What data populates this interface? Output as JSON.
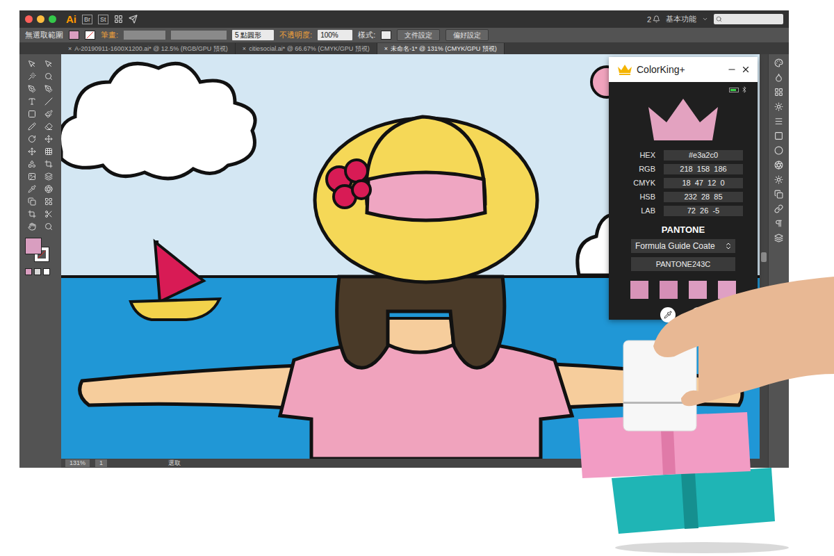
{
  "app": {
    "logo": "Ai",
    "bridge": "Br",
    "stock": "St",
    "notifications": "2",
    "workspace": "基本功能"
  },
  "control_bar": {
    "selection": "無選取範圍",
    "fill": "#d99ec0",
    "stroke_label": "筆畫:",
    "brush": "5 點圓形",
    "opacity_label": "不透明度:",
    "opacity": "100%",
    "style_label": "樣式:",
    "buttons": [
      "文件設定",
      "偏好設定"
    ]
  },
  "tabs": [
    {
      "close": "×",
      "label": "A-20190911-1600X1200.ai* @ 12.5% (RGB/GPU 預視)",
      "selected": false
    },
    {
      "close": "×",
      "label": "citiesocial.ai* @ 66.67% (CMYK/GPU 預視)",
      "selected": false
    },
    {
      "close": "×",
      "label": "未命名-1* @ 131% (CMYK/GPU 預視)",
      "selected": true
    }
  ],
  "tools": {
    "fill": "#d99ec0"
  },
  "status_bar": {
    "zoom": "131%",
    "page": "1",
    "tool": "選取"
  },
  "colorking": {
    "title": "ColorKing+",
    "battery_level": 0.8,
    "bluetooth": true,
    "color": "#e3a2c0",
    "readings": [
      {
        "label": "HEX",
        "value": "#e3a2c0"
      },
      {
        "label": "RGB",
        "value": "218  158  186"
      },
      {
        "label": "CMYK",
        "value": "18  47  12  0"
      },
      {
        "label": "HSB",
        "value": "232  28  85"
      },
      {
        "label": "LAB",
        "value": "72  26  -5"
      }
    ],
    "pantone": {
      "brand": "PANTONE",
      "guide": "Formula Guide Coate",
      "match": "PANTONE243C"
    },
    "swatches": [
      {
        "color": "#d893b8"
      },
      {
        "color": "#d58fb6"
      },
      {
        "color": "#dc9cc0"
      },
      {
        "color": "#dfa0c4"
      }
    ]
  }
}
